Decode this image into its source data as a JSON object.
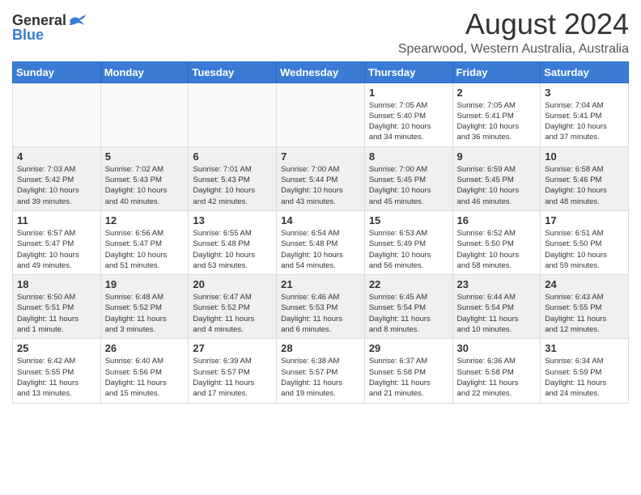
{
  "header": {
    "logo_line1": "General",
    "logo_line2": "Blue",
    "month_year": "August 2024",
    "location": "Spearwood, Western Australia, Australia"
  },
  "weekdays": [
    "Sunday",
    "Monday",
    "Tuesday",
    "Wednesday",
    "Thursday",
    "Friday",
    "Saturday"
  ],
  "weeks": [
    {
      "days": [
        {
          "num": "",
          "info": "",
          "empty": true
        },
        {
          "num": "",
          "info": "",
          "empty": true
        },
        {
          "num": "",
          "info": "",
          "empty": true
        },
        {
          "num": "",
          "info": "",
          "empty": true
        },
        {
          "num": "1",
          "info": "Sunrise: 7:05 AM\nSunset: 5:40 PM\nDaylight: 10 hours\nand 34 minutes.",
          "empty": false
        },
        {
          "num": "2",
          "info": "Sunrise: 7:05 AM\nSunset: 5:41 PM\nDaylight: 10 hours\nand 36 minutes.",
          "empty": false
        },
        {
          "num": "3",
          "info": "Sunrise: 7:04 AM\nSunset: 5:41 PM\nDaylight: 10 hours\nand 37 minutes.",
          "empty": false
        }
      ]
    },
    {
      "days": [
        {
          "num": "4",
          "info": "Sunrise: 7:03 AM\nSunset: 5:42 PM\nDaylight: 10 hours\nand 39 minutes.",
          "empty": false
        },
        {
          "num": "5",
          "info": "Sunrise: 7:02 AM\nSunset: 5:43 PM\nDaylight: 10 hours\nand 40 minutes.",
          "empty": false
        },
        {
          "num": "6",
          "info": "Sunrise: 7:01 AM\nSunset: 5:43 PM\nDaylight: 10 hours\nand 42 minutes.",
          "empty": false
        },
        {
          "num": "7",
          "info": "Sunrise: 7:00 AM\nSunset: 5:44 PM\nDaylight: 10 hours\nand 43 minutes.",
          "empty": false
        },
        {
          "num": "8",
          "info": "Sunrise: 7:00 AM\nSunset: 5:45 PM\nDaylight: 10 hours\nand 45 minutes.",
          "empty": false
        },
        {
          "num": "9",
          "info": "Sunrise: 6:59 AM\nSunset: 5:45 PM\nDaylight: 10 hours\nand 46 minutes.",
          "empty": false
        },
        {
          "num": "10",
          "info": "Sunrise: 6:58 AM\nSunset: 5:46 PM\nDaylight: 10 hours\nand 48 minutes.",
          "empty": false
        }
      ]
    },
    {
      "days": [
        {
          "num": "11",
          "info": "Sunrise: 6:57 AM\nSunset: 5:47 PM\nDaylight: 10 hours\nand 49 minutes.",
          "empty": false
        },
        {
          "num": "12",
          "info": "Sunrise: 6:56 AM\nSunset: 5:47 PM\nDaylight: 10 hours\nand 51 minutes.",
          "empty": false
        },
        {
          "num": "13",
          "info": "Sunrise: 6:55 AM\nSunset: 5:48 PM\nDaylight: 10 hours\nand 53 minutes.",
          "empty": false
        },
        {
          "num": "14",
          "info": "Sunrise: 6:54 AM\nSunset: 5:48 PM\nDaylight: 10 hours\nand 54 minutes.",
          "empty": false
        },
        {
          "num": "15",
          "info": "Sunrise: 6:53 AM\nSunset: 5:49 PM\nDaylight: 10 hours\nand 56 minutes.",
          "empty": false
        },
        {
          "num": "16",
          "info": "Sunrise: 6:52 AM\nSunset: 5:50 PM\nDaylight: 10 hours\nand 58 minutes.",
          "empty": false
        },
        {
          "num": "17",
          "info": "Sunrise: 6:51 AM\nSunset: 5:50 PM\nDaylight: 10 hours\nand 59 minutes.",
          "empty": false
        }
      ]
    },
    {
      "days": [
        {
          "num": "18",
          "info": "Sunrise: 6:50 AM\nSunset: 5:51 PM\nDaylight: 11 hours\nand 1 minute.",
          "empty": false
        },
        {
          "num": "19",
          "info": "Sunrise: 6:48 AM\nSunset: 5:52 PM\nDaylight: 11 hours\nand 3 minutes.",
          "empty": false
        },
        {
          "num": "20",
          "info": "Sunrise: 6:47 AM\nSunset: 5:52 PM\nDaylight: 11 hours\nand 4 minutes.",
          "empty": false
        },
        {
          "num": "21",
          "info": "Sunrise: 6:46 AM\nSunset: 5:53 PM\nDaylight: 11 hours\nand 6 minutes.",
          "empty": false
        },
        {
          "num": "22",
          "info": "Sunrise: 6:45 AM\nSunset: 5:54 PM\nDaylight: 11 hours\nand 8 minutes.",
          "empty": false
        },
        {
          "num": "23",
          "info": "Sunrise: 6:44 AM\nSunset: 5:54 PM\nDaylight: 11 hours\nand 10 minutes.",
          "empty": false
        },
        {
          "num": "24",
          "info": "Sunrise: 6:43 AM\nSunset: 5:55 PM\nDaylight: 11 hours\nand 12 minutes.",
          "empty": false
        }
      ]
    },
    {
      "days": [
        {
          "num": "25",
          "info": "Sunrise: 6:42 AM\nSunset: 5:55 PM\nDaylight: 11 hours\nand 13 minutes.",
          "empty": false
        },
        {
          "num": "26",
          "info": "Sunrise: 6:40 AM\nSunset: 5:56 PM\nDaylight: 11 hours\nand 15 minutes.",
          "empty": false
        },
        {
          "num": "27",
          "info": "Sunrise: 6:39 AM\nSunset: 5:57 PM\nDaylight: 11 hours\nand 17 minutes.",
          "empty": false
        },
        {
          "num": "28",
          "info": "Sunrise: 6:38 AM\nSunset: 5:57 PM\nDaylight: 11 hours\nand 19 minutes.",
          "empty": false
        },
        {
          "num": "29",
          "info": "Sunrise: 6:37 AM\nSunset: 5:58 PM\nDaylight: 11 hours\nand 21 minutes.",
          "empty": false
        },
        {
          "num": "30",
          "info": "Sunrise: 6:36 AM\nSunset: 5:58 PM\nDaylight: 11 hours\nand 22 minutes.",
          "empty": false
        },
        {
          "num": "31",
          "info": "Sunrise: 6:34 AM\nSunset: 5:59 PM\nDaylight: 11 hours\nand 24 minutes.",
          "empty": false
        }
      ]
    }
  ]
}
